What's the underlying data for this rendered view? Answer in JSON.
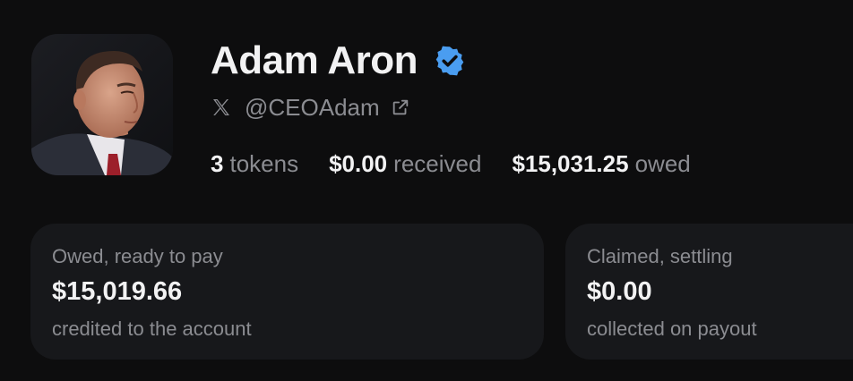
{
  "profile": {
    "name": "Adam Aron",
    "handle": "@CEOAdam",
    "verified": true,
    "verified_color": "#4a9df0",
    "platform_icon": "x-logo-icon",
    "external_link_icon": "external-link-icon"
  },
  "stats": [
    {
      "value": "3",
      "label": "tokens"
    },
    {
      "value": "$0.00",
      "label": "received"
    },
    {
      "value": "$15,031.25",
      "label": "owed"
    }
  ],
  "cards": [
    {
      "label": "Owed, ready to pay",
      "value": "$15,019.66",
      "sub": "credited to the account"
    },
    {
      "label": "Claimed, settling",
      "value": "$0.00",
      "sub": "collected on payout"
    }
  ],
  "colors": {
    "background": "#0d0d0e",
    "card_background": "#17181b",
    "primary_text": "#f2f2f3",
    "muted_text": "#8b8c91",
    "accent": "#4a9df0"
  }
}
